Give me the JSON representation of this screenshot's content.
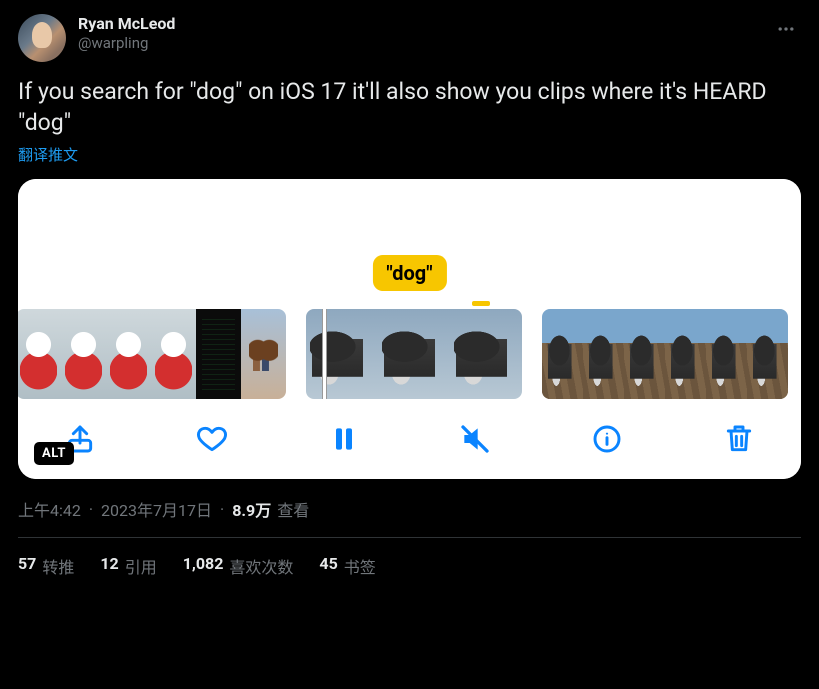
{
  "author": {
    "display_name": "Ryan McLeod",
    "handle": "@warpling"
  },
  "body": "If you search for \"dog\" on iOS 17 it'll also show you clips where it's HEARD \"dog\"",
  "translate_label": "翻译推文",
  "media": {
    "caption_bubble": "\"dog\"",
    "alt_badge": "ALT",
    "toolbar": {
      "share": "share",
      "like": "like",
      "pause": "pause",
      "mute": "mute",
      "info": "info",
      "delete": "delete"
    }
  },
  "meta": {
    "time": "上午4:42",
    "date": "2023年7月17日",
    "views_number": "8.9万",
    "views_label": "查看"
  },
  "stats": {
    "retweets_n": "57",
    "retweets_label": "转推",
    "quotes_n": "12",
    "quotes_label": "引用",
    "likes_n": "1,082",
    "likes_label": "喜欢次数",
    "bookmarks_n": "45",
    "bookmarks_label": "书签"
  }
}
